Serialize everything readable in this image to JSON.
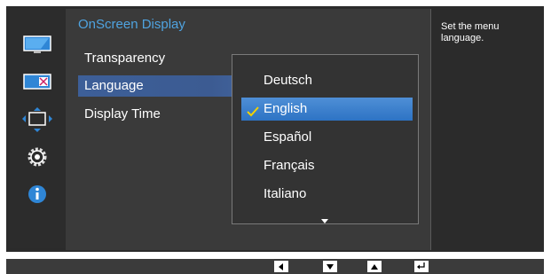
{
  "panel": {
    "title": "OnScreen Display"
  },
  "menu": {
    "items": [
      {
        "label": "Transparency"
      },
      {
        "label": "Language"
      },
      {
        "label": "Display Time"
      }
    ]
  },
  "dropdown": {
    "options": [
      {
        "label": "Deutsch"
      },
      {
        "label": "English"
      },
      {
        "label": "Español"
      },
      {
        "label": "Français"
      },
      {
        "label": "Italiano"
      }
    ],
    "selected": "English"
  },
  "help": {
    "text": "Set the menu language."
  },
  "colors": {
    "accent": "#4fa3e0",
    "selected_row": "#3d5f98",
    "selected_option": "#2d73c4"
  },
  "icons": [
    "picture-icon",
    "color-icon",
    "size-position-icon",
    "settings-icon",
    "information-icon"
  ],
  "bottom_keys": [
    "left-key-icon",
    "down-key-icon",
    "up-key-icon",
    "enter-key-icon"
  ]
}
